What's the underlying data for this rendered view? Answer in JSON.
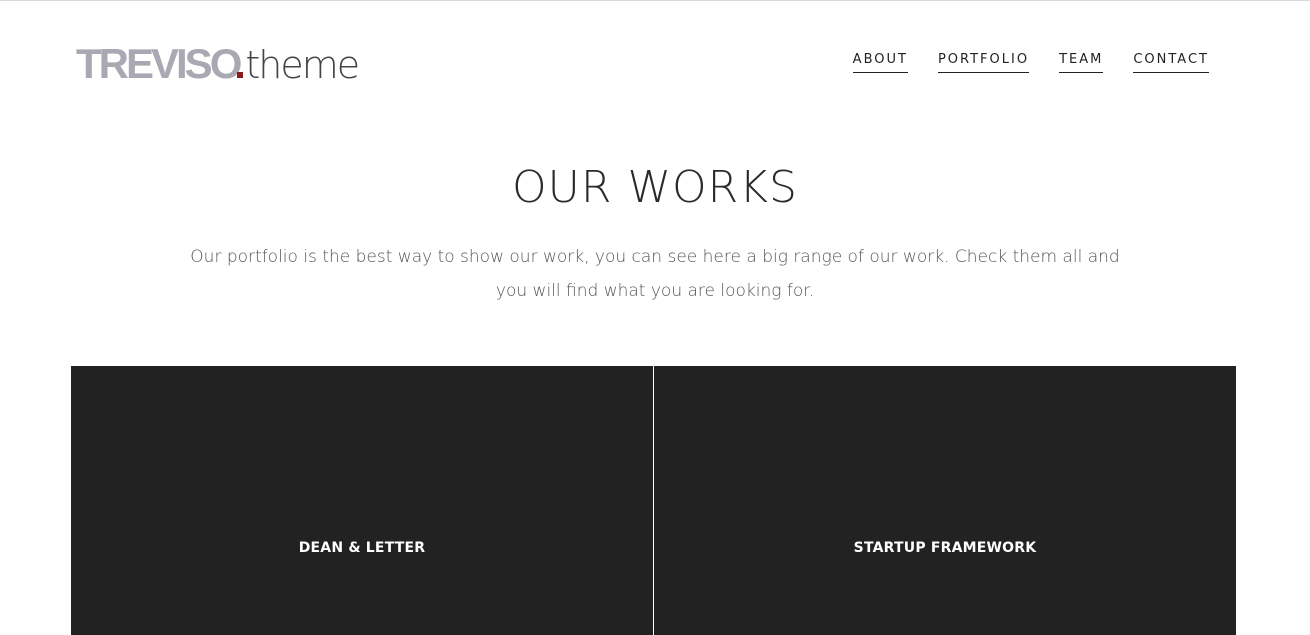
{
  "logo": {
    "brand": "TREVISO",
    "suffix": "theme"
  },
  "nav": [
    {
      "label": "ABOUT"
    },
    {
      "label": "PORTFOLIO"
    },
    {
      "label": "TEAM"
    },
    {
      "label": "CONTACT"
    }
  ],
  "section": {
    "title": "OUR WORKS",
    "description": "Our portfolio is the best way to show our work, you can see here a big range of our work. Check them all and you will find what you are looking for."
  },
  "portfolio": [
    {
      "title": "DEAN & LETTER"
    },
    {
      "title": "STARTUP FRAMEWORK"
    }
  ],
  "colors": {
    "logo_gray": "#a9a9b3",
    "logo_dot": "#8b1a1a",
    "card_bg": "#222222"
  }
}
